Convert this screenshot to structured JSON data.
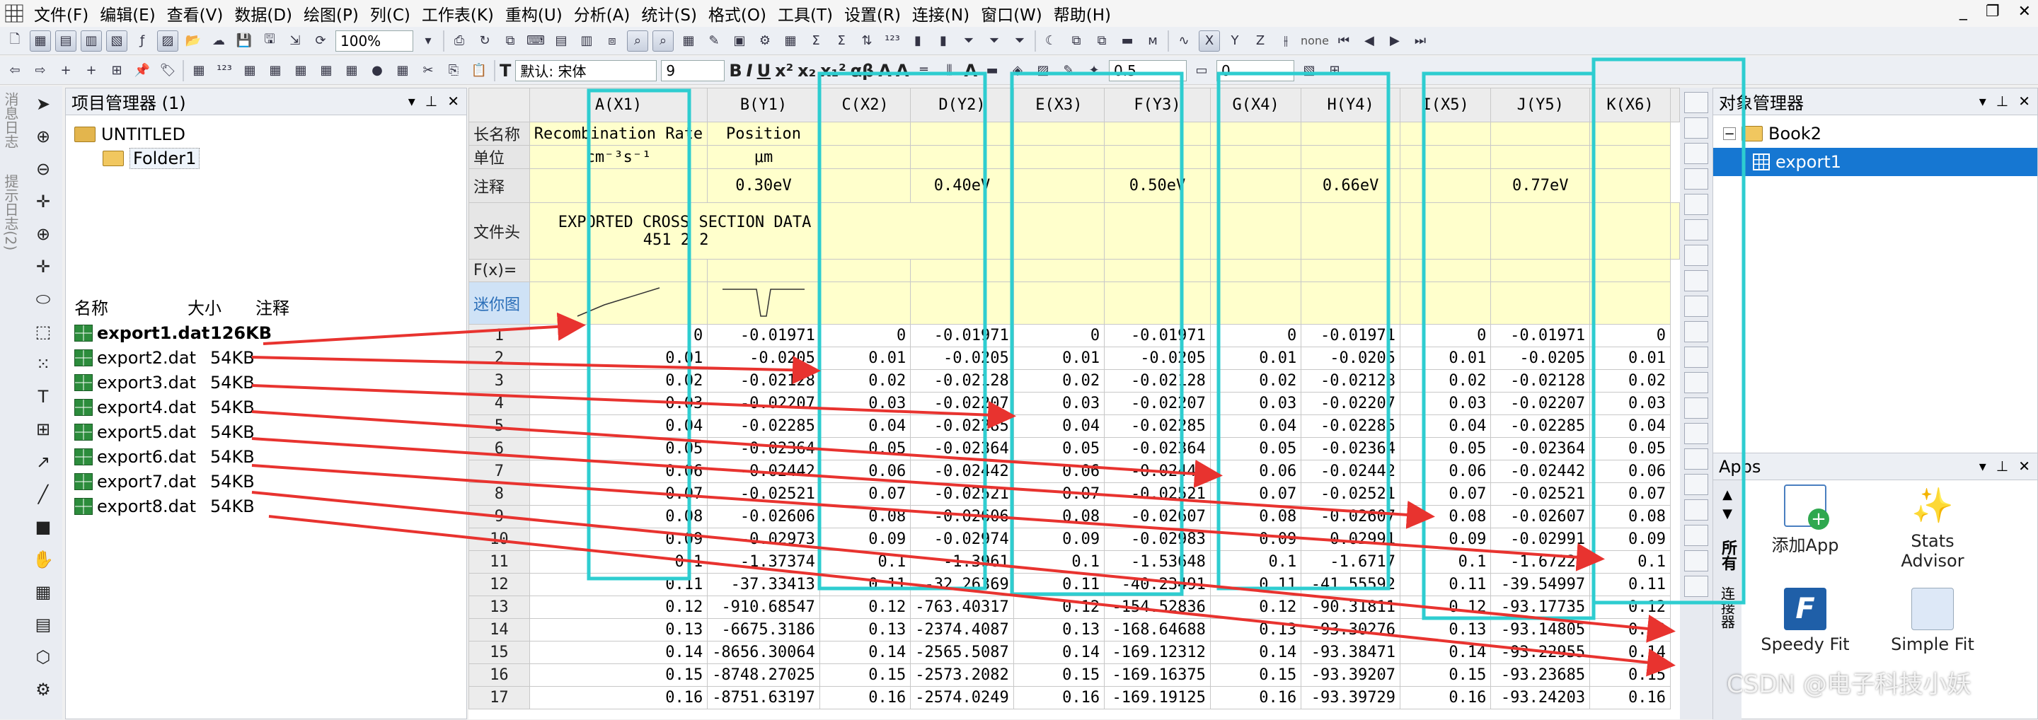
{
  "menubar": {
    "items": [
      "文件(F)",
      "编辑(E)",
      "查看(V)",
      "数据(D)",
      "绘图(P)",
      "列(C)",
      "工作表(K)",
      "重构(U)",
      "分析(A)",
      "统计(S)",
      "格式(O)",
      "工具(T)",
      "设置(R)",
      "连接(N)",
      "窗口(W)",
      "帮助(H)"
    ]
  },
  "toolbar": {
    "zoom": "100%",
    "font_name": "默认: 宋体",
    "font_size": "9",
    "line_width": "0.5",
    "other_value": "0",
    "none_label": "none"
  },
  "side_labels": [
    "消息日志",
    "提示日志(2)"
  ],
  "project_manager": {
    "title": "项目管理器 (1)",
    "root": "UNTITLED",
    "folder": "Folder1",
    "columns": [
      "名称",
      "大小",
      "注释"
    ],
    "files": [
      {
        "name": "export1.dat",
        "size": "126KB",
        "bold": true
      },
      {
        "name": "export2.dat",
        "size": "54KB"
      },
      {
        "name": "export3.dat",
        "size": "54KB"
      },
      {
        "name": "export4.dat",
        "size": "54KB"
      },
      {
        "name": "export5.dat",
        "size": "54KB"
      },
      {
        "name": "export6.dat",
        "size": "54KB"
      },
      {
        "name": "export7.dat",
        "size": "54KB"
      },
      {
        "name": "export8.dat",
        "size": "54KB"
      }
    ]
  },
  "sheet": {
    "columns": [
      "A(X1)",
      "B(Y1)",
      "C(X2)",
      "D(Y2)",
      "E(X3)",
      "F(Y3)",
      "G(X4)",
      "H(Y4)",
      "I(X5)",
      "J(Y5)",
      "K(X6)"
    ],
    "meta_labels": [
      "长名称",
      "单位",
      "注释",
      "文件头",
      "F(x)=",
      "迷你图"
    ],
    "long_names": {
      "A": "Recombination Rate",
      "B": "Position"
    },
    "units": {
      "A": "cm⁻³s⁻¹",
      "B": "μm"
    },
    "comments": {
      "B": "0.30eV",
      "D": "0.40eV",
      "F": "0.50eV",
      "H": "0.66eV",
      "J": "0.77eV"
    },
    "header_text": [
      "EXPORTED CROSS SECTION DATA",
      "451 2 2"
    ],
    "rows": [
      [
        "1",
        "0",
        "-0.01971",
        "0",
        "-0.01971",
        "0",
        "-0.01971",
        "0",
        "-0.01971",
        "0",
        "-0.01971",
        "0"
      ],
      [
        "2",
        "0.01",
        "-0.0205",
        "0.01",
        "-0.0205",
        "0.01",
        "-0.0205",
        "0.01",
        "-0.0205",
        "0.01",
        "-0.0205",
        "0.01"
      ],
      [
        "3",
        "0.02",
        "-0.02128",
        "0.02",
        "-0.02128",
        "0.02",
        "-0.02128",
        "0.02",
        "-0.02128",
        "0.02",
        "-0.02128",
        "0.02"
      ],
      [
        "4",
        "0.03",
        "-0.02207",
        "0.03",
        "-0.02207",
        "0.03",
        "-0.02207",
        "0.03",
        "-0.02207",
        "0.03",
        "-0.02207",
        "0.03"
      ],
      [
        "5",
        "0.04",
        "-0.02285",
        "0.04",
        "-0.02285",
        "0.04",
        "-0.02285",
        "0.04",
        "-0.02285",
        "0.04",
        "-0.02285",
        "0.04"
      ],
      [
        "6",
        "0.05",
        "-0.02364",
        "0.05",
        "-0.02364",
        "0.05",
        "-0.02364",
        "0.05",
        "-0.02364",
        "0.05",
        "-0.02364",
        "0.05"
      ],
      [
        "7",
        "0.06",
        "-0.02442",
        "0.06",
        "-0.02442",
        "0.06",
        "-0.02442",
        "0.06",
        "-0.02442",
        "0.06",
        "-0.02442",
        "0.06"
      ],
      [
        "8",
        "0.07",
        "-0.02521",
        "0.07",
        "-0.02521",
        "0.07",
        "-0.02521",
        "0.07",
        "-0.02521",
        "0.07",
        "-0.02521",
        "0.07"
      ],
      [
        "9",
        "0.08",
        "-0.02606",
        "0.08",
        "-0.02606",
        "0.08",
        "-0.02607",
        "0.08",
        "-0.02607",
        "0.08",
        "-0.02607",
        "0.08"
      ],
      [
        "10",
        "0.09",
        "-0.02973",
        "0.09",
        "-0.02974",
        "0.09",
        "-0.02983",
        "0.09",
        "-0.02991",
        "0.09",
        "-0.02991",
        "0.09"
      ],
      [
        "11",
        "0.1",
        "-1.37374",
        "0.1",
        "-1.3961",
        "0.1",
        "-1.53648",
        "0.1",
        "-1.6717",
        "0.1",
        "-1.67223",
        "0.1"
      ],
      [
        "12",
        "0.11",
        "-37.33413",
        "0.11",
        "-32.26369",
        "0.11",
        "-40.23491",
        "0.11",
        "-41.55592",
        "0.11",
        "-39.54997",
        "0.11"
      ],
      [
        "13",
        "0.12",
        "-910.68547",
        "0.12",
        "-763.40317",
        "0.12",
        "-154.52836",
        "0.12",
        "-90.31811",
        "0.12",
        "-93.17735",
        "0.12"
      ],
      [
        "14",
        "0.13",
        "-6675.3186",
        "0.13",
        "-2374.4087",
        "0.13",
        "-168.64688",
        "0.13",
        "-93.30276",
        "0.13",
        "-93.14805",
        "0.13"
      ],
      [
        "15",
        "0.14",
        "-8656.30064",
        "0.14",
        "-2565.5087",
        "0.14",
        "-169.12312",
        "0.14",
        "-93.38471",
        "0.14",
        "-93.22955",
        "0.14"
      ],
      [
        "16",
        "0.15",
        "-8748.27025",
        "0.15",
        "-2573.2082",
        "0.15",
        "-169.16375",
        "0.15",
        "-93.39207",
        "0.15",
        "-93.23685",
        "0.15"
      ],
      [
        "17",
        "0.16",
        "-8751.63197",
        "0.16",
        "-2574.0249",
        "0.16",
        "-169.19125",
        "0.16",
        "-93.39729",
        "0.16",
        "-93.24203",
        "0.16"
      ]
    ]
  },
  "object_manager": {
    "title": "对象管理器",
    "book": "Book2",
    "sheet": "export1"
  },
  "apps_panel": {
    "title": "Apps",
    "side_tabs": [
      "所有",
      "连接器"
    ],
    "apps": [
      "添加App",
      "Stats Advisor",
      "Speedy Fit",
      "Simple Fit"
    ]
  },
  "watermark": "CSDN @电子科技小妖",
  "colors": {
    "annotation_box": "#2ecdd0",
    "arrow": "#e8332f",
    "meta_bg": "#ffffcc",
    "selection": "#1677d2"
  }
}
